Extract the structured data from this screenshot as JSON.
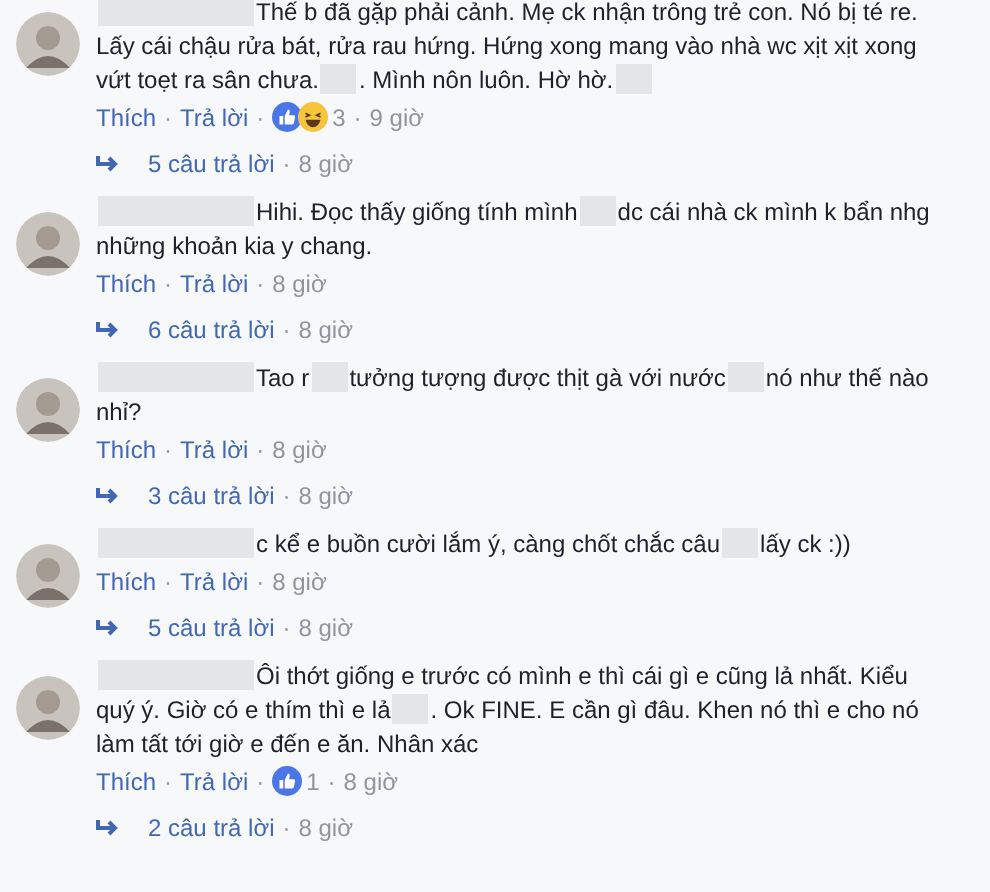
{
  "comments": [
    {
      "lines": [
        [
          {
            "kind": "name_blur"
          },
          {
            "kind": "text",
            "text": "Thế b đã gặp phải cảnh. Mẹ ck nhận trông trẻ con. Nó bị té re."
          }
        ],
        [
          {
            "kind": "text",
            "text": "Lấy cái chậu rửa bát, rửa rau hứng. Hứng xong mang vào nhà wc xịt xịt xong"
          }
        ],
        [
          {
            "kind": "text",
            "text": "vứt toẹt ra sân chưa."
          },
          {
            "kind": "word_blur"
          },
          {
            "kind": "text",
            "text": ". Mình nôn luôn. Hờ hờ."
          },
          {
            "kind": "word_blur"
          }
        ]
      ],
      "like": "Thích",
      "separator": "·",
      "reply": "Trả lời",
      "reactions": [
        {
          "kind": "like"
        },
        {
          "kind": "haha"
        }
      ],
      "reaction_count": "3",
      "time": "9 giờ",
      "replies": "5 câu trả lời",
      "replies_time": "8 giờ"
    },
    {
      "lines": [
        [
          {
            "kind": "name_blur"
          },
          {
            "kind": "text",
            "text": "Hihi. Đọc thấy giống tính mình"
          },
          {
            "kind": "word_blur"
          },
          {
            "kind": "text",
            "text": "dc cái nhà ck mình k bẩn nhg"
          }
        ],
        [
          {
            "kind": "text",
            "text": "những khoản kia y chang."
          }
        ]
      ],
      "like": "Thích",
      "separator": "·",
      "reply": "Trả lời",
      "time": "8 giờ",
      "replies": "6 câu trả lời",
      "replies_time": "8 giờ"
    },
    {
      "lines": [
        [
          {
            "kind": "name_blur"
          },
          {
            "kind": "text",
            "text": "Tao r"
          },
          {
            "kind": "word_blur"
          },
          {
            "kind": "text",
            "text": "tưởng tượng được thịt gà với nước"
          },
          {
            "kind": "word_blur"
          },
          {
            "kind": "text",
            "text": "nó như thế nào"
          }
        ],
        [
          {
            "kind": "text",
            "text": "nhỉ?"
          }
        ]
      ],
      "like": "Thích",
      "separator": "·",
      "reply": "Trả lời",
      "time": "8 giờ",
      "replies": "3 câu trả lời",
      "replies_time": "8 giờ"
    },
    {
      "lines": [
        [
          {
            "kind": "name_blur"
          },
          {
            "kind": "text",
            "text": "c kể e buồn cười lắm ý, càng chốt chắc câu"
          },
          {
            "kind": "word_blur"
          },
          {
            "kind": "text",
            "text": "lấy ck :))"
          }
        ]
      ],
      "like": "Thích",
      "separator": "·",
      "reply": "Trả lời",
      "time": "8 giờ",
      "replies": "5 câu trả lời",
      "replies_time": "8 giờ"
    },
    {
      "lines": [
        [
          {
            "kind": "name_blur"
          },
          {
            "kind": "text",
            "text": "Ôi thớt giống e trước có mình e thì cái gì e cũng lả nhất. Kiểu"
          }
        ],
        [
          {
            "kind": "text",
            "text": "quý ý. Giờ có e thím thì e lả"
          },
          {
            "kind": "word_blur"
          },
          {
            "kind": "text",
            "text": ". Ok FINE. E cần gì đâu. Khen nó thì e cho nó"
          }
        ],
        [
          {
            "kind": "text",
            "text": "làm tất tới giờ e đến e ăn. Nhân xác"
          }
        ]
      ],
      "like": "Thích",
      "separator": "·",
      "reply": "Trả lời",
      "reactions": [
        {
          "kind": "like"
        }
      ],
      "reaction_count": "1",
      "time": "8 giờ",
      "replies": "2 câu trả lời",
      "replies_time": "8 giờ"
    }
  ]
}
